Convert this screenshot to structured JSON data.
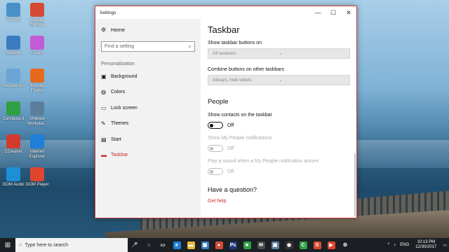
{
  "desktop": {
    "icons": [
      {
        "label": "This PC",
        "icon": "computer-icon",
        "color": "#4a90c8"
      },
      {
        "label": "Google Chrome",
        "icon": "chrome-icon",
        "color": "#d64a35"
      },
      {
        "label": "Network",
        "icon": "network-icon",
        "color": "#3b7bbf"
      },
      {
        "label": "iTunes",
        "icon": "itunes-icon",
        "color": "#c25bd6"
      },
      {
        "label": "Recycle Bin",
        "icon": "recycle-bin-icon",
        "color": "#6aa5d6"
      },
      {
        "label": "Mozilla Firefox",
        "icon": "firefox-icon",
        "color": "#e56a1e"
      },
      {
        "label": "Camtasia 9",
        "icon": "camtasia-icon",
        "color": "#2f9e44"
      },
      {
        "label": "VMware Workstat...",
        "icon": "vmware-icon",
        "color": "#5b7f9b"
      },
      {
        "label": "CCleaner",
        "icon": "ccleaner-icon",
        "color": "#d03b2f"
      },
      {
        "label": "Internet Explorer",
        "icon": "ie-icon",
        "color": "#1e7fd6"
      },
      {
        "label": "GOM Audio",
        "icon": "gom-audio-icon",
        "color": "#1e8fd6"
      },
      {
        "label": "GOM Player",
        "icon": "gom-player-icon",
        "color": "#e0452e"
      }
    ]
  },
  "window": {
    "title": "Settings",
    "minimize_glyph": "—",
    "maximize_glyph": "☐",
    "close_glyph": "✕"
  },
  "sidebar": {
    "home_label": "Home",
    "search_placeholder": "Find a setting",
    "section_label": "Personalization",
    "items": [
      {
        "label": "Background",
        "icon": "image-icon",
        "glyph": "▣"
      },
      {
        "label": "Colors",
        "icon": "palette-icon",
        "glyph": "◍"
      },
      {
        "label": "Lock screen",
        "icon": "monitor-icon",
        "glyph": "▭"
      },
      {
        "label": "Themes",
        "icon": "brush-icon",
        "glyph": "✎"
      },
      {
        "label": "Start",
        "icon": "start-icon",
        "glyph": "▤"
      },
      {
        "label": "Taskbar",
        "icon": "taskbar-icon",
        "glyph": "▬",
        "active": true
      }
    ]
  },
  "content": {
    "title": "Taskbar",
    "show_buttons_label": "Show taskbar buttons on",
    "show_buttons_value": "All taskbars",
    "combine_label": "Combine buttons on other taskbars",
    "combine_value": "Always, hide labels",
    "people_heading": "People",
    "contacts_label": "Show contacts on the taskbar",
    "contacts_state": "Off",
    "notifications_label": "Show My People notifications",
    "notifications_state": "Off",
    "sound_label": "Play a sound when a My People notification arrives",
    "sound_state": "Off",
    "question": "Have a question?",
    "help_link": "Get help"
  },
  "taskbar": {
    "search_placeholder": "Type here to search",
    "apps": [
      {
        "icon": "microphone-icon",
        "glyph": "🎤",
        "color": "transparent"
      },
      {
        "icon": "cortana-icon",
        "glyph": "○",
        "color": "transparent"
      },
      {
        "icon": "task-view-icon",
        "glyph": "▭",
        "color": "transparent"
      },
      {
        "icon": "edge-icon",
        "glyph": "e",
        "color": "#1e7fd6"
      },
      {
        "icon": "file-explorer-icon",
        "glyph": "▬",
        "color": "#e8b83a"
      },
      {
        "icon": "store-icon",
        "glyph": "▦",
        "color": "#3b7bbf"
      },
      {
        "icon": "chrome-icon",
        "glyph": "●",
        "color": "#d64a35"
      },
      {
        "icon": "photoshop-icon",
        "glyph": "Ps",
        "color": "#1e3b78"
      },
      {
        "icon": "camtasia-icon",
        "glyph": "■",
        "color": "#2f9e44"
      },
      {
        "icon": "mail-icon",
        "glyph": "✉",
        "color": "#4a4a4a"
      },
      {
        "icon": "vmware-icon",
        "glyph": "▣",
        "color": "#5b7f9b"
      },
      {
        "icon": "media-icon",
        "glyph": "◉",
        "color": "#333"
      },
      {
        "icon": "camtasia-recorder-icon",
        "glyph": "C",
        "color": "#2f9e44"
      },
      {
        "icon": "snagit-icon",
        "glyph": "S",
        "color": "#d64a35"
      },
      {
        "icon": "gom-player-icon",
        "glyph": "▶",
        "color": "#e0452e"
      },
      {
        "icon": "settings-icon",
        "glyph": "⚙",
        "color": "transparent"
      }
    ],
    "lang": "ENG",
    "time": "10:13 PM",
    "date": "12/30/2017"
  }
}
